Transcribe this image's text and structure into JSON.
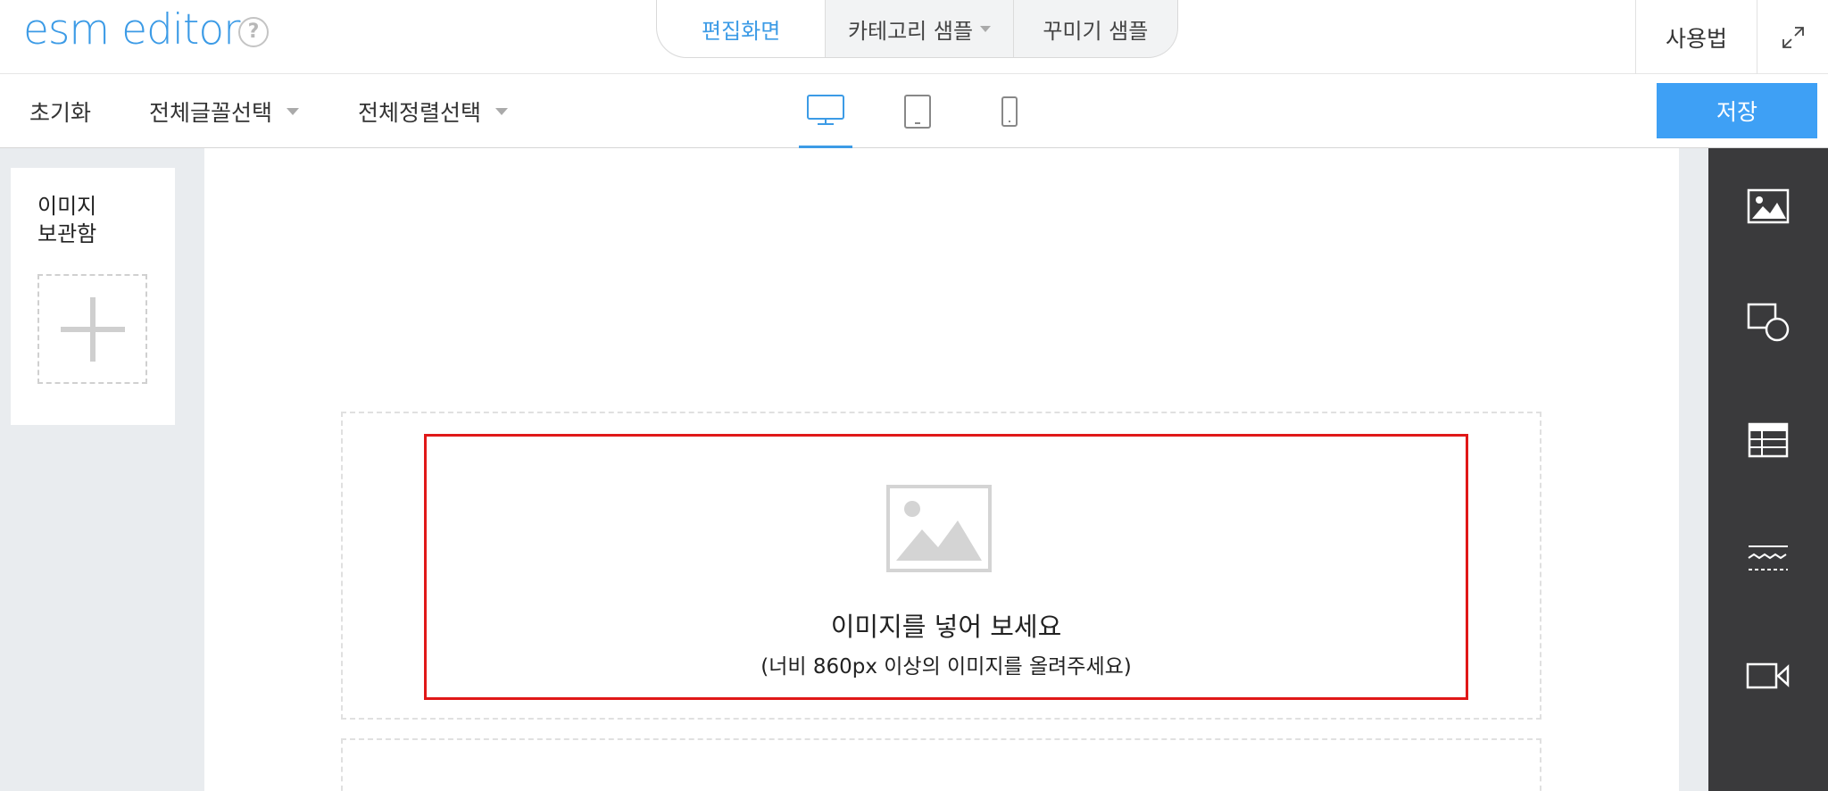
{
  "header": {
    "logo": "esm editor",
    "help": "?",
    "tabs": [
      {
        "label": "편집화면"
      },
      {
        "label": "카테고리 샘플"
      },
      {
        "label": "꾸미기 샘플"
      }
    ],
    "howto_label": "사용법"
  },
  "toolbar": {
    "reset_label": "초기화",
    "font_select_label": "전체글꼴선택",
    "align_select_label": "전체정렬선택",
    "save_label": "저장"
  },
  "left_panel": {
    "title": "이미지\n보관함"
  },
  "editor": {
    "drop_title": "이미지를 넣어 보세요",
    "drop_subtitle": "(너비 860px 이상의 이미지를 올려주세요)"
  },
  "icons": {
    "help": "question-circle-icon",
    "expand": "expand-icon",
    "desktop": "desktop-icon",
    "tablet": "tablet-icon",
    "mobile": "mobile-icon",
    "add": "plus-icon",
    "image_placeholder": "image-placeholder-icon",
    "right_tools": [
      "image-icon",
      "shapes-icon",
      "table-icon",
      "divider-icon",
      "video-icon"
    ]
  },
  "colors": {
    "accent": "#3c9be6",
    "save": "#3ea0f5",
    "highlight": "#e01818",
    "sidebar": "#3a3a3c"
  }
}
